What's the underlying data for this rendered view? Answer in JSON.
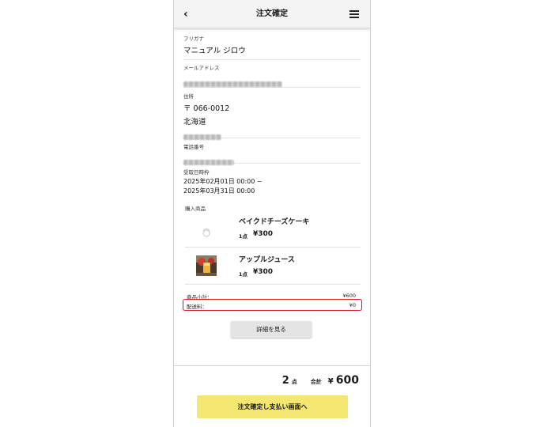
{
  "header": {
    "title": "注文確定",
    "back_icon": "‹"
  },
  "fields": {
    "furigana": {
      "label": "フリガナ",
      "value": "マニュアル ジロウ"
    },
    "email": {
      "label": "メールアドレス",
      "value_redacted": true
    },
    "address": {
      "label": "住所",
      "postal": "〒 066-0012",
      "prefecture": "北海道",
      "detail_redacted": true
    },
    "phone": {
      "label": "電話番号",
      "value_redacted": true
    },
    "pickup": {
      "label": "受取日時枠",
      "start": "2025年02月01日 00:00 ~",
      "end": "2025年03月31日 00:00"
    }
  },
  "products": {
    "label": "購入商品",
    "items": [
      {
        "name": "ベイクドチーズケーキ",
        "qty": "1点",
        "price": "¥300",
        "image": "placeholder-image-icon"
      },
      {
        "name": "アップルジュース",
        "qty": "1点",
        "price": "¥300",
        "image": "juice-photo"
      }
    ]
  },
  "summary": {
    "subtotal_label": "商品小計：",
    "subtotal_value": "¥600",
    "shipping_label": "配送料：",
    "shipping_value": "¥0",
    "highlight_color": "#d9141c"
  },
  "detail_button": "詳細を見る",
  "footer": {
    "count": "2",
    "count_unit": "点",
    "total_label": "合計",
    "yen": "¥",
    "total_amount": "600",
    "confirm_button": "注文確定し支払い画面へ",
    "confirm_color": "#f3e671"
  }
}
